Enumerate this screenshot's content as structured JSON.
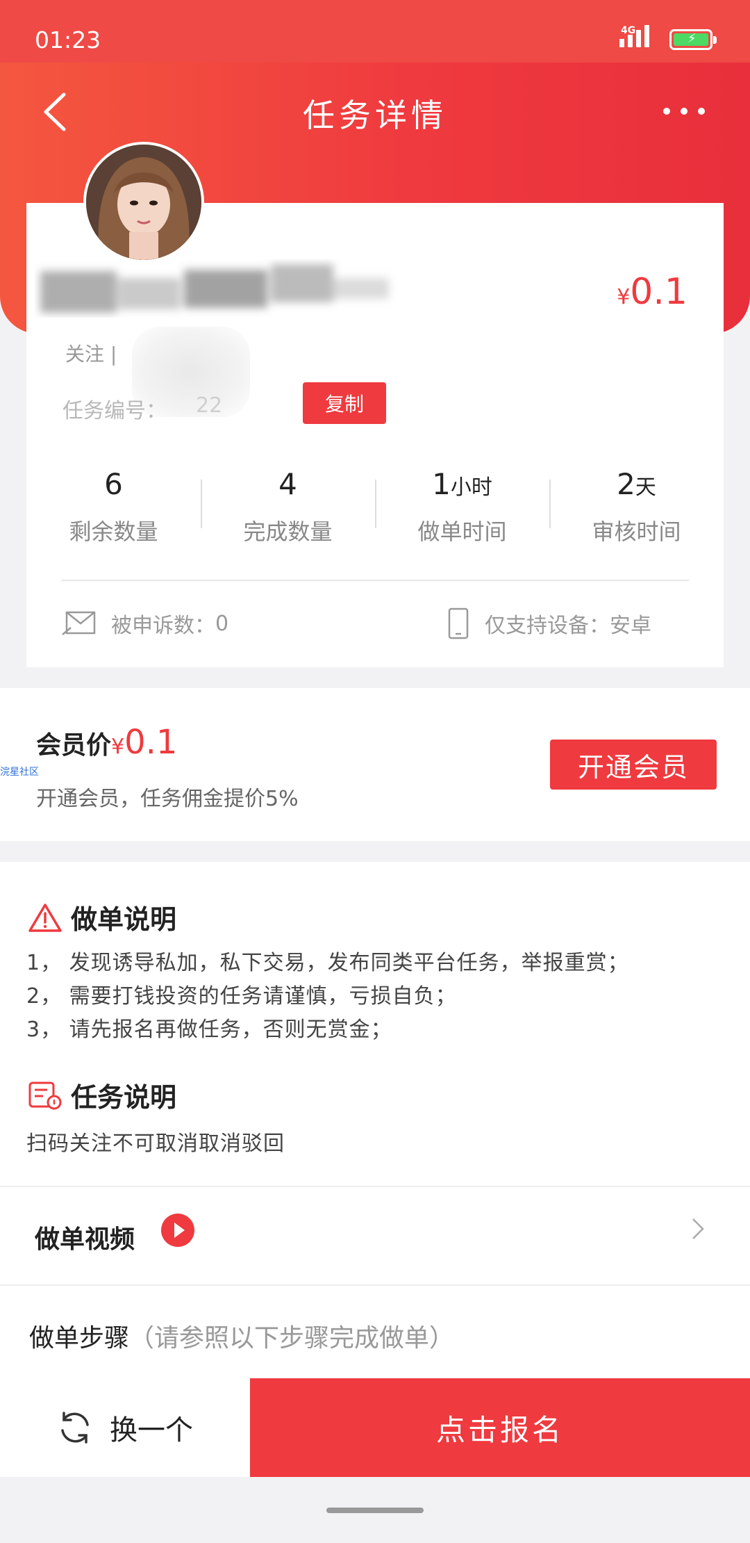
{
  "status_bar": {
    "time": "01:23",
    "network": "4G"
  },
  "header": {
    "title": "任务详情"
  },
  "task": {
    "price_symbol": "¥",
    "price_value": "0.1",
    "follow_prefix": "关注 | ",
    "task_number_label": "任务编号：",
    "task_number_value": "22",
    "copy_button": "复制"
  },
  "stats": [
    {
      "value": "6",
      "unit": "",
      "label": "剩余数量"
    },
    {
      "value": "4",
      "unit": "",
      "label": "完成数量"
    },
    {
      "value": "1",
      "unit": "小时",
      "label": "做单时间"
    },
    {
      "value": "2",
      "unit": "天",
      "label": "审核时间"
    }
  ],
  "complaints": {
    "label": "被申诉数：",
    "value": "0"
  },
  "device": {
    "label": "仅支持设备：",
    "value": "安卓"
  },
  "member": {
    "title": "会员价",
    "price_symbol": "¥",
    "price_value": "0.1",
    "subtitle": "开通会员，任务佣金提价5%",
    "button": "开通会员"
  },
  "watermark": "浣星社区",
  "instructions": {
    "title": "做单说明",
    "lines": [
      "1， 发现诱导私加，私下交易，发布同类平台任务，举报重赏；",
      "2， 需要打钱投资的任务请谨慎，亏损自负；",
      "3， 请先报名再做任务，否则无赏金；"
    ]
  },
  "task_desc": {
    "title": "任务说明",
    "text": "扫码关注不可取消取消驳回"
  },
  "video": {
    "label": "做单视频"
  },
  "steps": {
    "label": "做单步骤",
    "hint": "（请参照以下步骤完成做单）"
  },
  "bottom": {
    "swap": "换一个",
    "signup": "点击报名"
  },
  "colors": {
    "accent": "#ef3a3f",
    "background": "#f2f2f4"
  }
}
